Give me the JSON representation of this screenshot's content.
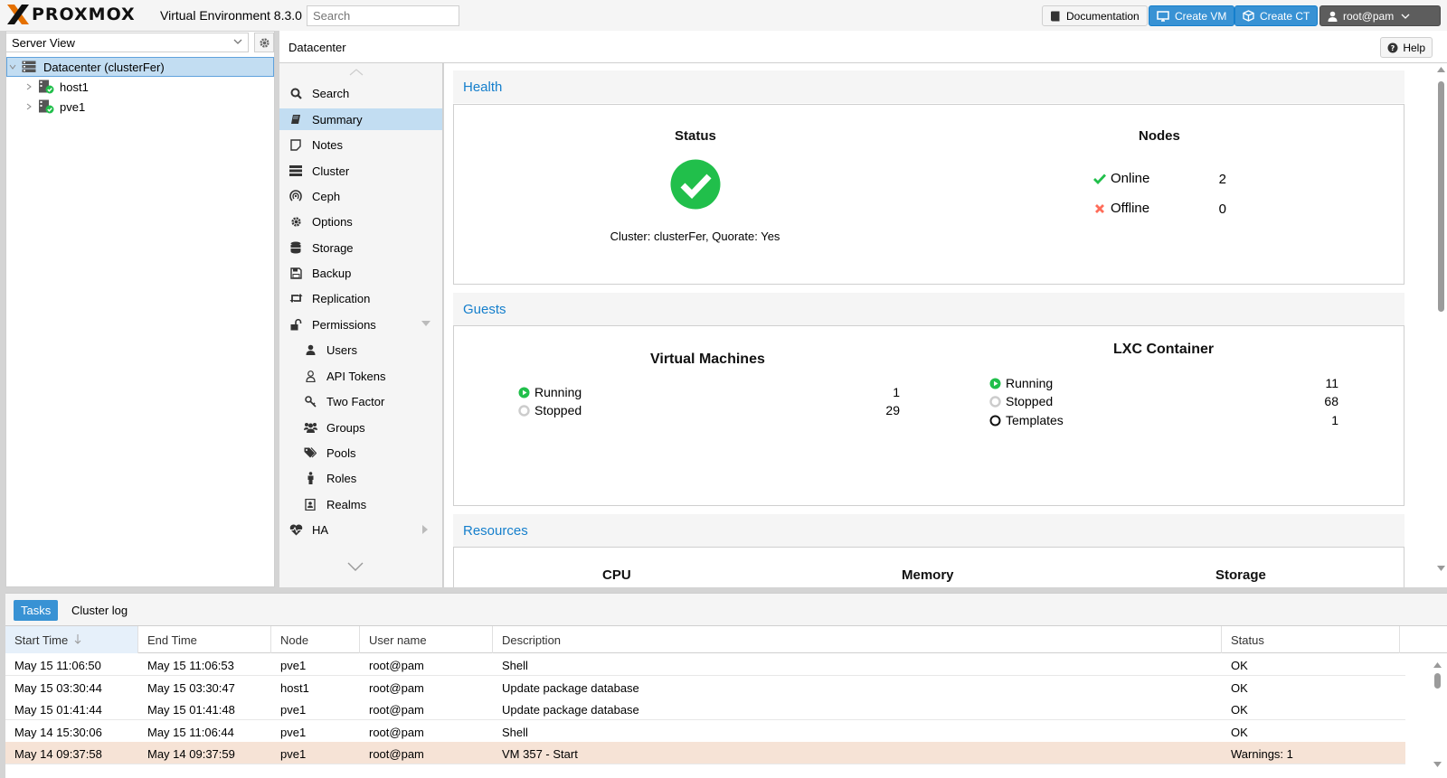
{
  "app": {
    "logo_text": "PROXMOX",
    "version": "Virtual Environment 8.3.0",
    "search_placeholder": "Search"
  },
  "toolbar": {
    "documentation": "Documentation",
    "create_vm": "Create VM",
    "create_ct": "Create CT",
    "user": "root@pam"
  },
  "tree": {
    "view": "Server View",
    "items": [
      {
        "label": "Datacenter (clusterFer)",
        "icon": "datacenter-icon"
      },
      {
        "label": "host1",
        "icon": "node-online-icon"
      },
      {
        "label": "pve1",
        "icon": "node-online-icon"
      }
    ]
  },
  "content": {
    "title": "Datacenter",
    "help": "Help"
  },
  "nav": {
    "items": [
      {
        "label": "Search",
        "icon": "search-icon"
      },
      {
        "label": "Summary",
        "icon": "book-icon"
      },
      {
        "label": "Notes",
        "icon": "notes-icon"
      },
      {
        "label": "Cluster",
        "icon": "cluster-icon"
      },
      {
        "label": "Ceph",
        "icon": "ceph-icon"
      },
      {
        "label": "Options",
        "icon": "gear-icon"
      },
      {
        "label": "Storage",
        "icon": "database-icon"
      },
      {
        "label": "Backup",
        "icon": "floppy-icon"
      },
      {
        "label": "Replication",
        "icon": "retweet-icon"
      },
      {
        "label": "Permissions",
        "icon": "unlock-icon"
      },
      {
        "label": "Users",
        "icon": "user-icon"
      },
      {
        "label": "API Tokens",
        "icon": "user-outline-icon"
      },
      {
        "label": "Two Factor",
        "icon": "key-icon"
      },
      {
        "label": "Groups",
        "icon": "users-icon"
      },
      {
        "label": "Pools",
        "icon": "tags-icon"
      },
      {
        "label": "Roles",
        "icon": "male-icon"
      },
      {
        "label": "Realms",
        "icon": "address-book-icon"
      },
      {
        "label": "HA",
        "icon": "heartbeat-icon"
      }
    ],
    "active": "Summary"
  },
  "health": {
    "section_title": "Health",
    "status_heading": "Status",
    "status_text": "Cluster: clusterFer, Quorate: Yes",
    "nodes_heading": "Nodes",
    "online_label": "Online",
    "online_count": "2",
    "offline_label": "Offline",
    "offline_count": "0"
  },
  "guests": {
    "section_title": "Guests",
    "vm_heading": "Virtual Machines",
    "vm_running_label": "Running",
    "vm_running": "1",
    "vm_stopped_label": "Stopped",
    "vm_stopped": "29",
    "lxc_heading": "LXC Container",
    "lxc_running_label": "Running",
    "lxc_running": "11",
    "lxc_stopped_label": "Stopped",
    "lxc_stopped": "68",
    "lxc_templates_label": "Templates",
    "lxc_templates": "1"
  },
  "resources": {
    "section_title": "Resources",
    "cpu": "CPU",
    "memory": "Memory",
    "storage": "Storage"
  },
  "tasks": {
    "tabs": [
      "Tasks",
      "Cluster log"
    ],
    "columns": [
      "Start Time",
      "End Time",
      "Node",
      "User name",
      "Description",
      "Status"
    ],
    "rows": [
      [
        "May 15 11:06:50",
        "May 15 11:06:53",
        "pve1",
        "root@pam",
        "Shell",
        "OK"
      ],
      [
        "May 15 03:30:44",
        "May 15 03:30:47",
        "host1",
        "root@pam",
        "Update package database",
        "OK"
      ],
      [
        "May 15 01:41:44",
        "May 15 01:41:48",
        "pve1",
        "root@pam",
        "Update package database",
        "OK"
      ],
      [
        "May 14 15:30:06",
        "May 15 11:06:44",
        "pve1",
        "root@pam",
        "Shell",
        "OK"
      ],
      [
        "May 14 09:37:58",
        "May 14 09:37:59",
        "pve1",
        "root@pam",
        "VM 357 - Start",
        "Warnings: 1"
      ]
    ]
  },
  "colors": {
    "accent": "#3892d4",
    "ok_green": "#21bf4b",
    "error_red": "#ff6c59",
    "logo_orange": "#e57000",
    "warning_row": "#f6e3d6"
  }
}
